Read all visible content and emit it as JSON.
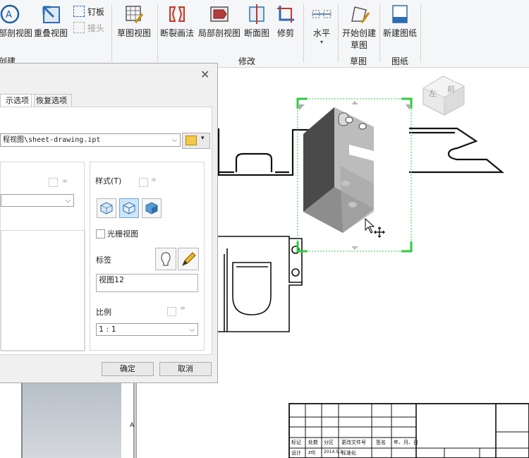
{
  "ribbon": {
    "items": {
      "section_view": "局部剖视图",
      "overlay_view": "重叠视图",
      "nail": "钉板",
      "connect": "接头",
      "sketch_view": "草图视图",
      "break": "断裂画法",
      "break_out": "局部剖视图",
      "slice": "断面图",
      "crop": "修剪",
      "horizontal": "水平",
      "start_sketch_line1": "开始创建",
      "start_sketch_line2": "草图",
      "new_sheet": "新建图纸"
    },
    "groups": {
      "create": "创建",
      "modify": "修改",
      "sketch": "草图",
      "sheet": "图纸"
    }
  },
  "dialog": {
    "tabs": [
      "示选项",
      "恢复选项"
    ],
    "file_path": "程视图\\sheet-drawing.ipt",
    "style_label": "样式(T)",
    "raster_label": "光栅视图",
    "label_label": "标签",
    "label_value": "视图12",
    "scale_label": "比例",
    "scale_value": "1 : 1",
    "ok": "确定",
    "cancel": "取消"
  },
  "viewcube": {
    "left": "左",
    "front": "前"
  },
  "titleblock": {
    "header_cells": [
      "标记",
      "处数",
      "分区",
      "更改文件号",
      "签名",
      "年、月、日"
    ],
    "row_cells": [
      "设计",
      "zdj",
      "2014.5.2",
      "标准化"
    ],
    "margin_mark": "A"
  },
  "colors": {
    "selection_green": "#2ecc40",
    "ribbon_bg": "#f5f6f7",
    "dialog_bg": "#f0f0f0",
    "accent_blue": "#6aa9d6"
  }
}
